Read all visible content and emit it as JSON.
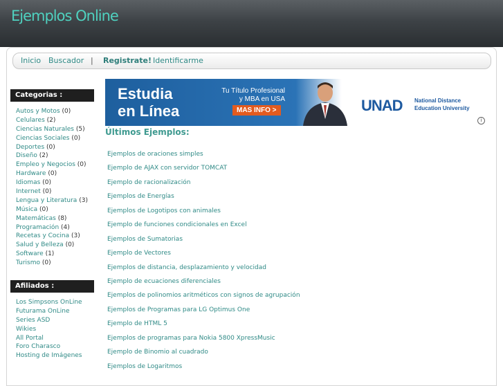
{
  "site": {
    "title": "Ejemplos Online"
  },
  "nav": {
    "items": [
      "Inicio",
      "Buscador"
    ],
    "separator": "|",
    "register": "Registrate!",
    "login": "Identificarme"
  },
  "sidebar": {
    "categories_heading": "Categorias :",
    "categories": [
      {
        "name": "Autos y Motos",
        "count": "(0)"
      },
      {
        "name": "Celulares",
        "count": "(2)"
      },
      {
        "name": "Ciencias Naturales",
        "count": "(5)"
      },
      {
        "name": "Ciencias Sociales",
        "count": "(0)"
      },
      {
        "name": "Deportes",
        "count": "(0)"
      },
      {
        "name": "Diseño",
        "count": "(2)"
      },
      {
        "name": "Empleo y Negocios",
        "count": "(0)"
      },
      {
        "name": "Hardware",
        "count": "(0)"
      },
      {
        "name": "Idiomas",
        "count": "(0)"
      },
      {
        "name": "Internet",
        "count": "(0)"
      },
      {
        "name": "Lengua y Literatura",
        "count": "(3)"
      },
      {
        "name": "Música",
        "count": "(0)"
      },
      {
        "name": "Matemáticas",
        "count": "(8)"
      },
      {
        "name": "Programación",
        "count": "(4)"
      },
      {
        "name": "Recetas y Cocina",
        "count": "(3)"
      },
      {
        "name": "Salud y Belleza",
        "count": "(0)"
      },
      {
        "name": "Software",
        "count": "(1)"
      },
      {
        "name": "Turismo",
        "count": "(0)"
      }
    ],
    "affiliates_heading": "Afiliados :",
    "affiliates": [
      "Los Simpsons OnLine",
      "Futurama OnLine",
      "Series ASD",
      "Wikies",
      "All Portal",
      "Foro Charasco",
      "Hosting de Imágenes"
    ]
  },
  "banner": {
    "headline_line1": "Estudia",
    "headline_line2": "en Línea",
    "tagline_line1": "Tu Título Profesional",
    "tagline_line2": "y MBA en USA",
    "button": "MAS INFO >",
    "logo": "UNAD",
    "university_line1": "National Distance",
    "university_line2": "Education University",
    "info_icon": "i"
  },
  "main": {
    "title": "Últimos Ejemplos:",
    "examples": [
      "Ejemplos de oraciones simples",
      "Ejemplo de AJAX con servidor TOMCAT",
      "Ejemplo de racionalización",
      "Ejemplos de Energías",
      "Ejemplos de Logotipos con animales",
      "Ejemplo de funciones condicionales en Excel",
      "Ejemplos de Sumatorias",
      "Ejemplo de Vectores",
      "Ejemplos de distancia, desplazamiento y velocidad",
      "Ejemplo de ecuaciones diferenciales",
      "Ejemplos de polinomios aritméticos con signos de agrupación",
      "Ejemplos de Programas para LG Optimus One",
      "Ejemplo de HTML 5",
      "Ejemplos de programas para Nokia 5800 XpressMusic",
      "Ejemplo de Binomio al cuadrado",
      "Ejemplos de Logaritmos"
    ]
  },
  "colors": {
    "title_accent": "#4fd1bf",
    "link": "#2f8a86",
    "header_dark": "#2a2e31",
    "sidebar_heading_bg": "#1f1f1f"
  }
}
